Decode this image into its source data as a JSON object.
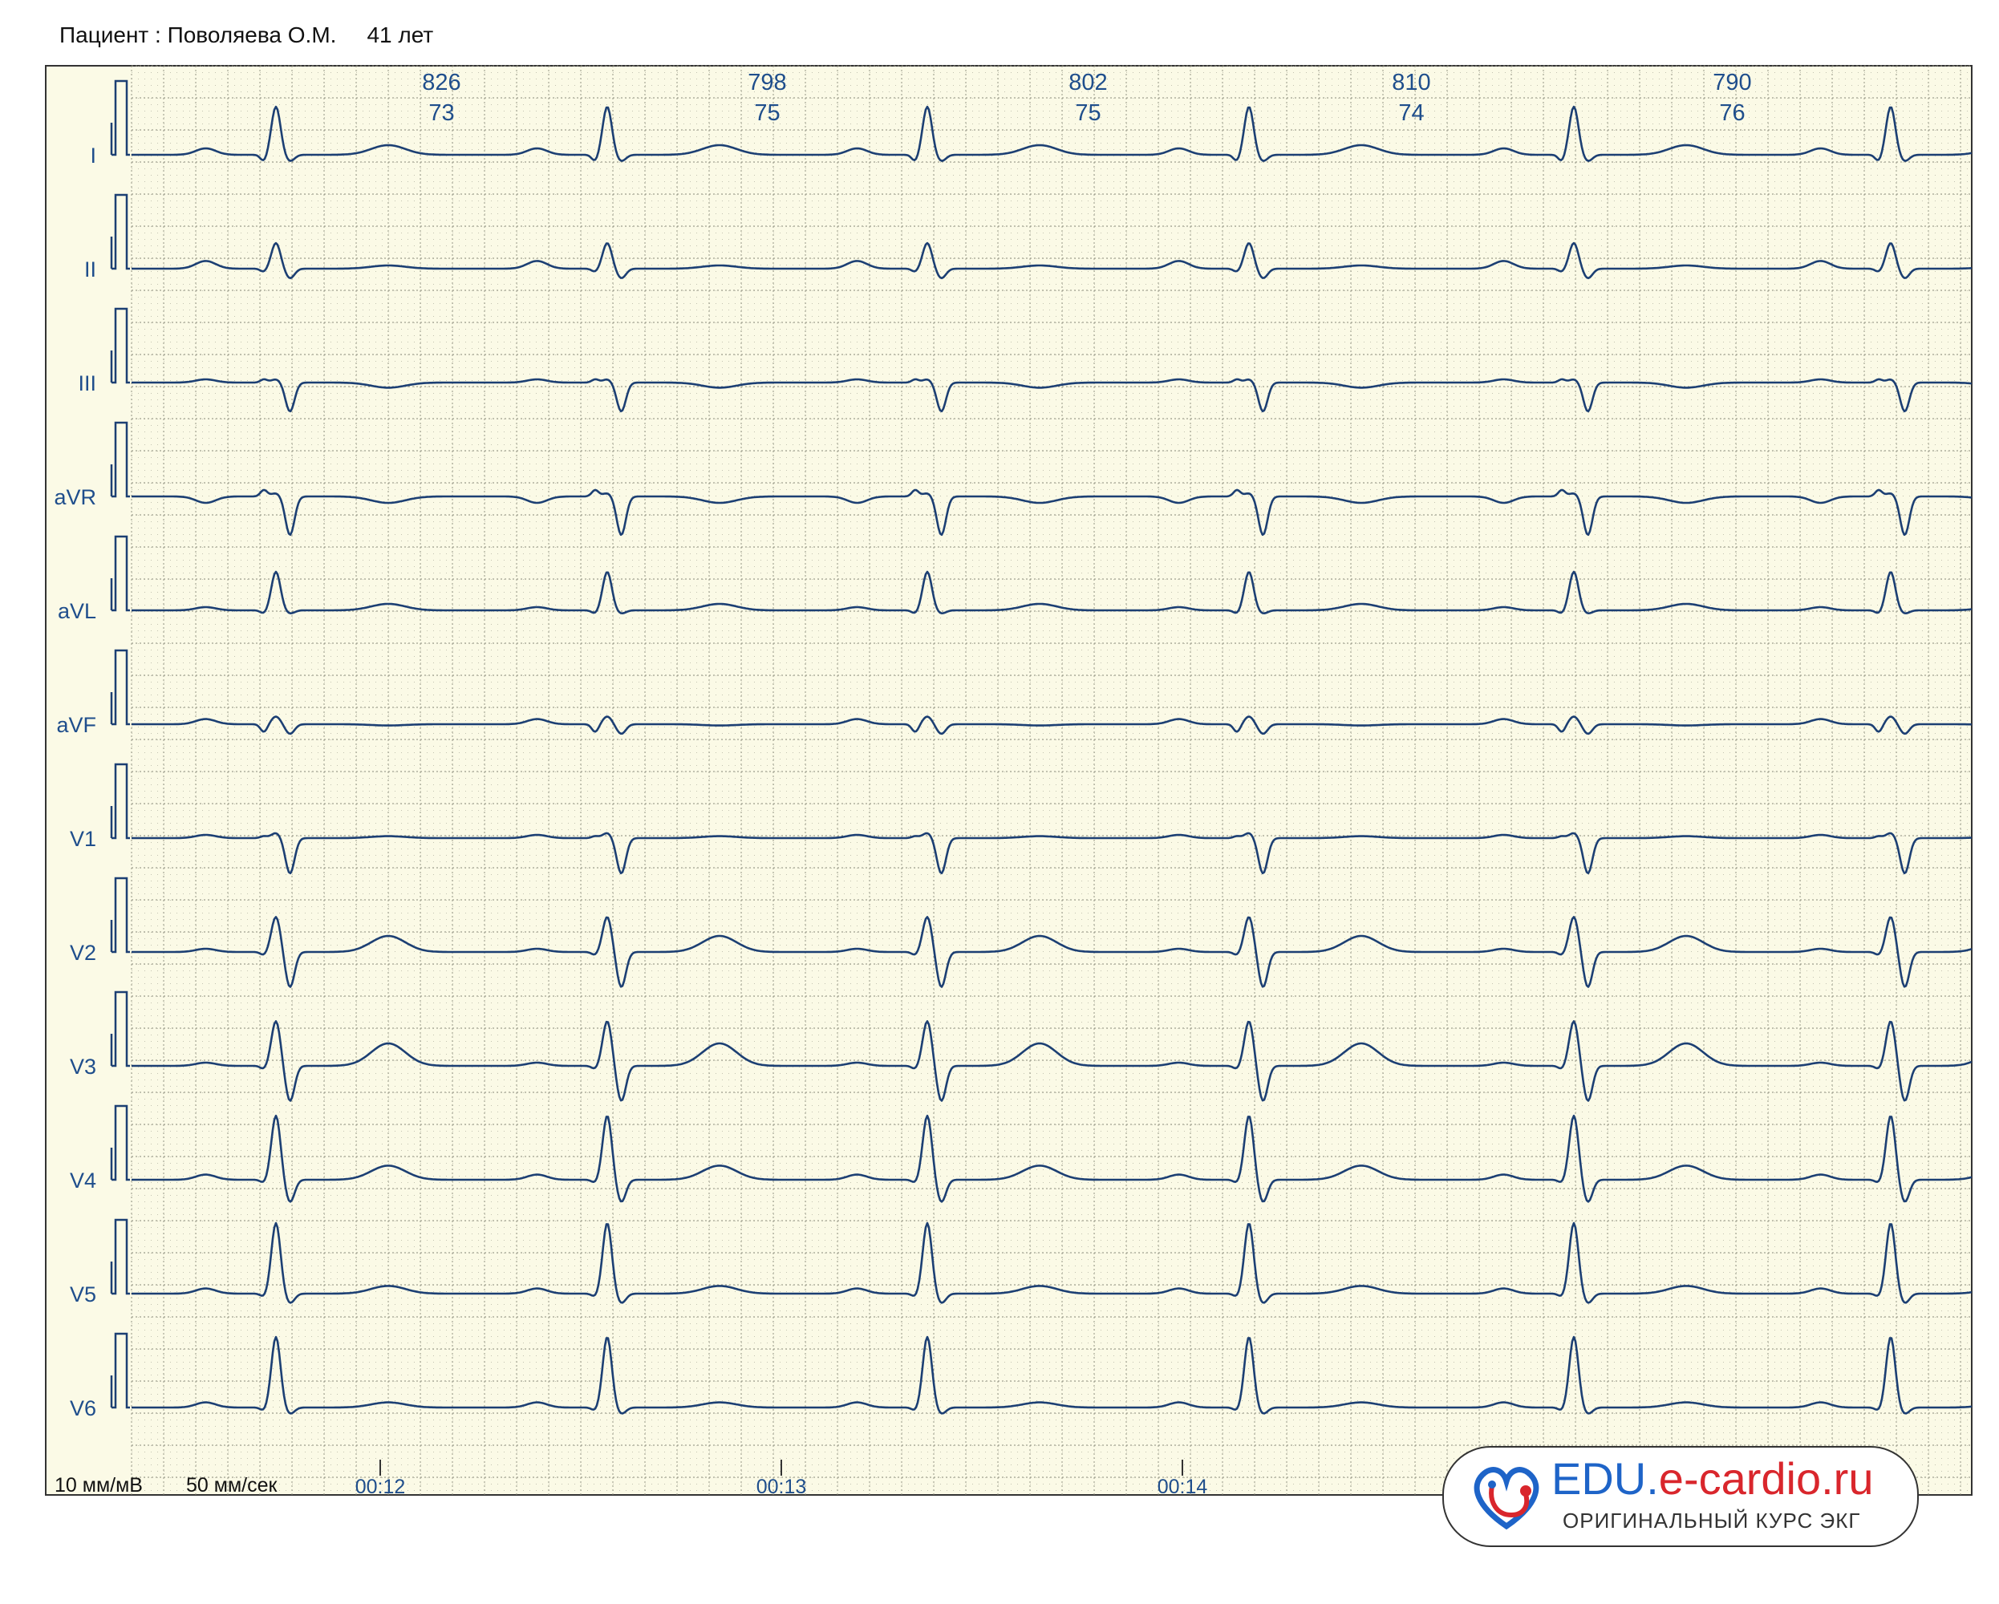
{
  "header": {
    "patient": "Пациент : Поволяева О.М.",
    "age": "41 лет"
  },
  "footer": {
    "gain": "10 мм/мВ",
    "speed": "50 мм/сек"
  },
  "logo": {
    "main_a": "EDU.",
    "main_b": "e-cardio.ru",
    "subtitle": "ОРИГИНАЛЬНЫЙ КУРС ЭКГ"
  },
  "colors": {
    "paper": "#fbfae6",
    "grid": "#8a8a7a",
    "trace": "#1c3f73",
    "label": "#1f4e8c"
  },
  "chart_data": {
    "type": "line",
    "title": "",
    "paper_speed_mm_s": 50,
    "gain_mm_mV": 10,
    "leads": [
      "I",
      "II",
      "III",
      "aVR",
      "aVL",
      "aVF",
      "V1",
      "V2",
      "V3",
      "V4",
      "V5",
      "V6"
    ],
    "rr_intervals_ms": [
      826,
      798,
      802,
      810,
      790
    ],
    "heart_rate_bpm": [
      73,
      75,
      75,
      74,
      76
    ],
    "time_ticks": [
      "00:12",
      "00:13",
      "00:14"
    ],
    "time_tick_values_s": [
      12,
      13,
      14
    ],
    "x_range_s": [
      11.38,
      15.99
    ],
    "beat_times_s": [
      11.74,
      12.566,
      13.364,
      14.166,
      14.976,
      15.766
    ],
    "lead_amplitudes_mV": {
      "I": {
        "P": 0.1,
        "Q": -0.1,
        "R": 0.75,
        "S": -0.1,
        "T": 0.15
      },
      "II": {
        "P": 0.12,
        "Q": -0.05,
        "R": 0.4,
        "S": -0.15,
        "T": 0.05
      },
      "III": {
        "P": 0.05,
        "Q": 0.05,
        "R": 0.05,
        "S": -0.45,
        "T": -0.08
      },
      "aVR": {
        "P": -0.1,
        "Q": 0.1,
        "R": 0.05,
        "S": -0.6,
        "T": -0.1
      },
      "aVL": {
        "P": 0.05,
        "Q": -0.05,
        "R": 0.6,
        "S": -0.05,
        "T": 0.1
      },
      "aVF": {
        "P": 0.08,
        "Q": -0.12,
        "R": 0.12,
        "S": -0.15,
        "T": -0.02
      },
      "V1": {
        "P": 0.05,
        "Q": 0.03,
        "R": 0.08,
        "S": -0.55,
        "T": 0.03
      },
      "V2": {
        "P": 0.05,
        "Q": -0.05,
        "R": 0.55,
        "S": -0.55,
        "T": 0.25
      },
      "V3": {
        "P": 0.05,
        "Q": -0.05,
        "R": 0.7,
        "S": -0.55,
        "T": 0.35
      },
      "V4": {
        "P": 0.08,
        "Q": -0.05,
        "R": 1.0,
        "S": -0.35,
        "T": 0.22
      },
      "V5": {
        "P": 0.08,
        "Q": -0.05,
        "R": 1.1,
        "S": -0.15,
        "T": 0.12
      },
      "V6": {
        "P": 0.08,
        "Q": -0.05,
        "R": 1.1,
        "S": -0.1,
        "T": 0.08
      }
    }
  }
}
